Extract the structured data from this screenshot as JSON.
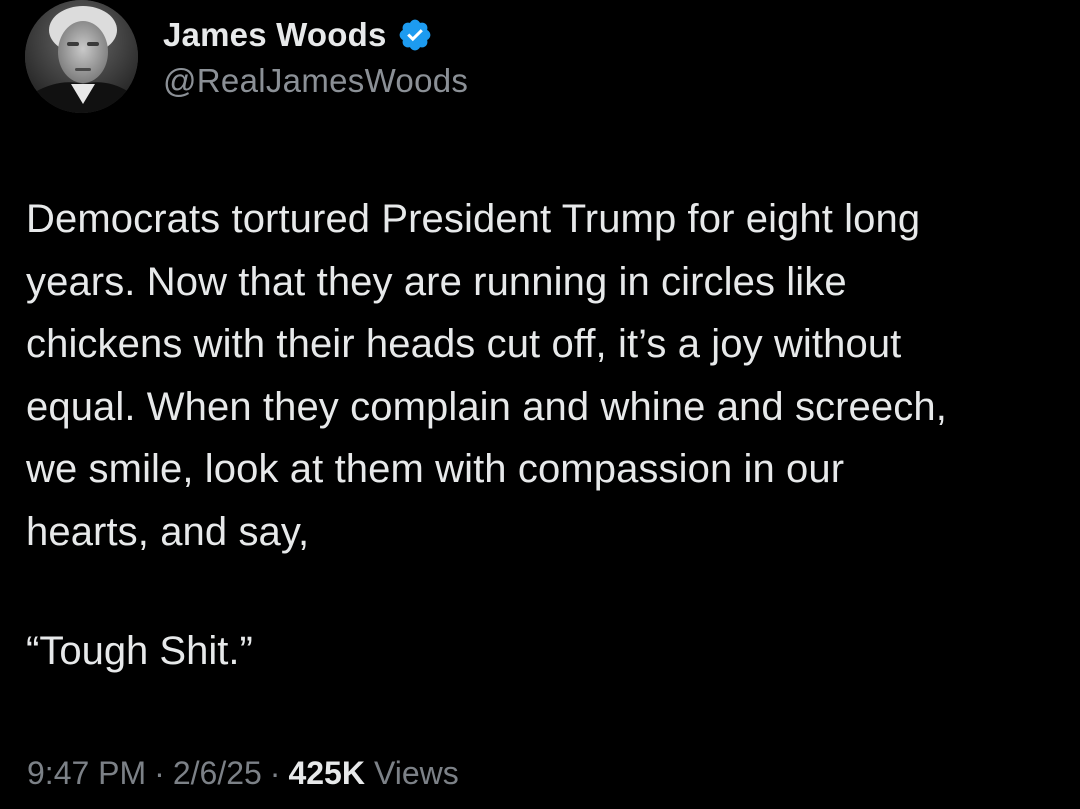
{
  "author": {
    "name": "James Woods",
    "handle": "@RealJamesWoods",
    "verified_icon": "verified-badge-icon",
    "verified_color": "#1d9bf0"
  },
  "tweet": {
    "lines": [
      "Democrats tortured President Trump for eight long",
      "years. Now that they are running in circles like",
      "chickens with their heads cut off, it’s a joy without",
      "equal. When they complain and whine and screech,",
      "we smile, look at them with compassion in our",
      "hearts, and say,"
    ],
    "quote": "“Tough Shit.”"
  },
  "meta": {
    "time": "9:47 PM",
    "separator": "·",
    "date": "2/6/25",
    "views_count": "425K",
    "views_label": "Views"
  }
}
